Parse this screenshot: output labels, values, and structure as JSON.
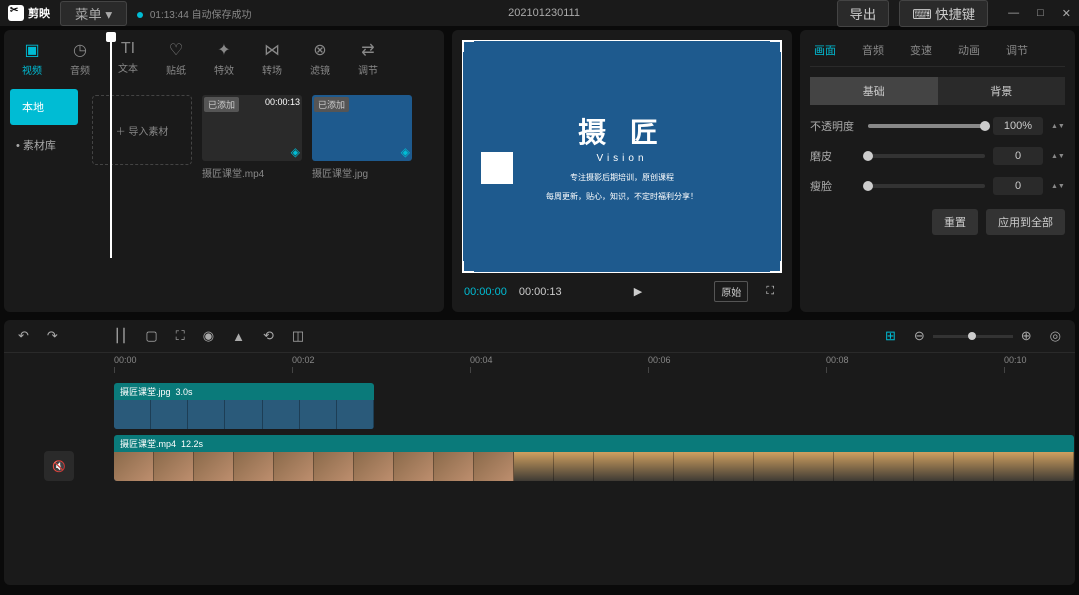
{
  "app": {
    "name": "剪映",
    "menu": "菜单"
  },
  "save": {
    "time": "01:13:44",
    "text": "自动保存成功"
  },
  "project": "202101230111",
  "export": "导出",
  "shortcut": "快捷键",
  "tabs": [
    {
      "icon": "▣",
      "label": "视频"
    },
    {
      "icon": "◷",
      "label": "音频"
    },
    {
      "icon": "TI",
      "label": "文本"
    },
    {
      "icon": "♡",
      "label": "贴纸"
    },
    {
      "icon": "✦",
      "label": "特效"
    },
    {
      "icon": "⋈",
      "label": "转场"
    },
    {
      "icon": "⊗",
      "label": "滤镜"
    },
    {
      "icon": "⇄",
      "label": "调节"
    }
  ],
  "sideTabs": {
    "local": "本地",
    "lib": "• 素材库"
  },
  "import": "＋ 导入素材",
  "media": [
    {
      "badge": "已添加",
      "dur": "00:00:13",
      "name": "摄匠课堂.mp4",
      "blue": false
    },
    {
      "badge": "已添加",
      "dur": "",
      "name": "摄匠课堂.jpg",
      "blue": true
    }
  ],
  "preview": {
    "logo": "摄 匠",
    "sub": "Vision",
    "line1": "专注摄影后期培训，原创课程",
    "line2": "每周更新，贴心，知识，不定时福利分享！",
    "cur": "00:00:00",
    "total": "00:00:13",
    "ratio": "原始"
  },
  "props": {
    "tabs": [
      "画面",
      "音频",
      "变速",
      "动画",
      "调节"
    ],
    "sub": [
      "基础",
      "背景"
    ],
    "opacity": {
      "label": "不透明度",
      "val": "100%"
    },
    "skin": {
      "label": "磨皮",
      "val": "0"
    },
    "face": {
      "label": "瘦脸",
      "val": "0"
    },
    "reset": "重置",
    "applyAll": "应用到全部"
  },
  "timeline": {
    "ticks": [
      "00:00",
      "00:02",
      "00:04",
      "00:06",
      "00:08",
      "00:10"
    ],
    "clip1": {
      "name": "摄匠课堂.jpg",
      "dur": "3.0s"
    },
    "clip2": {
      "name": "摄匠课堂.mp4",
      "dur": "12.2s"
    }
  }
}
